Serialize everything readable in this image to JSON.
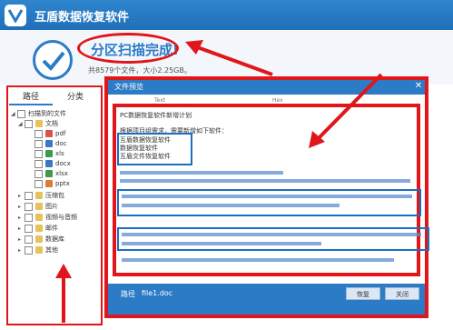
{
  "app": {
    "title": "互盾数据恢复软件"
  },
  "status": {
    "headline": "分区扫描完成!",
    "summary": "共8579个文件，大小2.25GB。"
  },
  "tree": {
    "tabs": [
      "路径",
      "分类"
    ],
    "root": "扫描到的文件",
    "documents": {
      "label": "文档",
      "children": [
        "pdf",
        "doc",
        "xls",
        "docx",
        "xlsx",
        "pptx"
      ]
    },
    "categories": [
      "压缩包",
      "图片",
      "视频与音频",
      "邮件",
      "数据库",
      "其他"
    ]
  },
  "preview": {
    "title": "文件预览",
    "columns": {
      "text": "Text",
      "hex": "Hex"
    },
    "lines": [
      "PC数据恢复软件新增计划",
      "根据项目组需求，需要新增如下软件：",
      "互盾数据恢复软件",
      "数据恢复软件",
      "互盾文件恢复软件"
    ],
    "path_label": "路径",
    "path_value": "file1.doc",
    "buttons": {
      "restore": "恢复",
      "close": "关闭"
    }
  },
  "colors": {
    "accent": "#2b7bc6",
    "annotation": "#e0161b"
  },
  "icons": {
    "app_logo": "shield-v-icon",
    "scan_done": "checkmark-icon",
    "file_types": "document-icon",
    "close": "close-icon"
  }
}
